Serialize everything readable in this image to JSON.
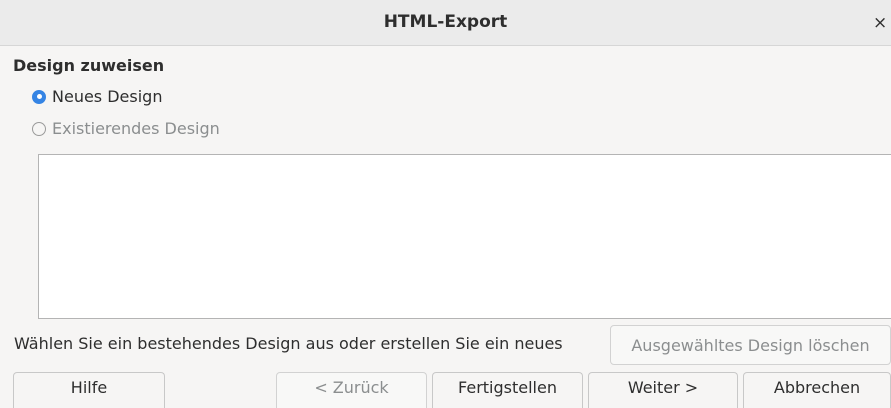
{
  "window": {
    "title": "HTML-Export",
    "close_glyph": "×"
  },
  "design_section": {
    "heading": "Design zuweisen",
    "options": [
      {
        "label": "Neues Design",
        "selected": true,
        "enabled": true
      },
      {
        "label": "Existierendes Design",
        "selected": false,
        "enabled": false
      }
    ],
    "hint": "Wählen Sie ein bestehendes Design aus oder erstellen Sie ein neues",
    "delete_button_label": "Ausgewähltes Design löschen"
  },
  "footer": {
    "help_label": "Hilfe",
    "back_label": "< Zurück",
    "finish_label": "Fertigstellen",
    "next_label": "Weiter >",
    "cancel_label": "Abbrechen"
  },
  "colors": {
    "accent": "#3584e4",
    "disabled_text": "#8b8e8f"
  },
  "icons": {
    "close": "close-icon",
    "radio_checked": "radio-checked-icon",
    "radio_unchecked": "radio-unchecked-icon"
  }
}
